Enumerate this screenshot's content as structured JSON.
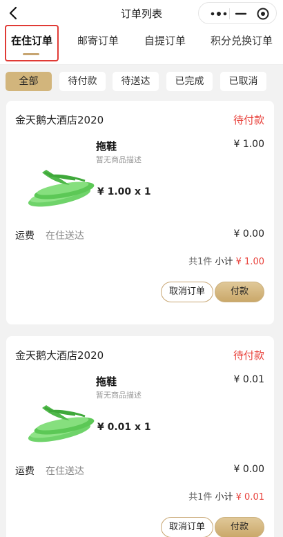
{
  "navbar": {
    "title": "订单列表"
  },
  "tabs": [
    {
      "label": "在住订单"
    },
    {
      "label": "邮寄订单"
    },
    {
      "label": "自提订单"
    },
    {
      "label": "积分兑换订单"
    }
  ],
  "filters": [
    {
      "label": "全部"
    },
    {
      "label": "待付款"
    },
    {
      "label": "待送达"
    },
    {
      "label": "已完成"
    },
    {
      "label": "已取消"
    }
  ],
  "orders": [
    {
      "shop": "金天鹅大酒店2020",
      "status": "待付款",
      "product": {
        "name": "拖鞋",
        "desc": "暂无商品描述",
        "price": "¥ 1.00",
        "qty_line": "¥ 1.00 x 1"
      },
      "shipping": {
        "label": "运费",
        "method": "在住送达",
        "fee": "¥ 0.00"
      },
      "summary": {
        "count": "共1件",
        "subtotal_label": "小计",
        "total": "¥ 1.00"
      },
      "buttons": {
        "cancel": "取消订单",
        "pay": "付款"
      }
    },
    {
      "shop": "金天鹅大酒店2020",
      "status": "待付款",
      "product": {
        "name": "拖鞋",
        "desc": "暂无商品描述",
        "price": "¥ 0.01",
        "qty_line": "¥ 0.01 x 1"
      },
      "shipping": {
        "label": "运费",
        "method": "在住送达",
        "fee": "¥ 0.00"
      },
      "summary": {
        "count": "共1件",
        "subtotal_label": "小计",
        "total": "¥ 0.01"
      },
      "buttons": {
        "cancel": "取消订单",
        "pay": "付款"
      }
    }
  ],
  "colors": {
    "accent_gold": "#d2b57c",
    "status_red": "#e8403a",
    "highlight_red": "#e03a35"
  }
}
